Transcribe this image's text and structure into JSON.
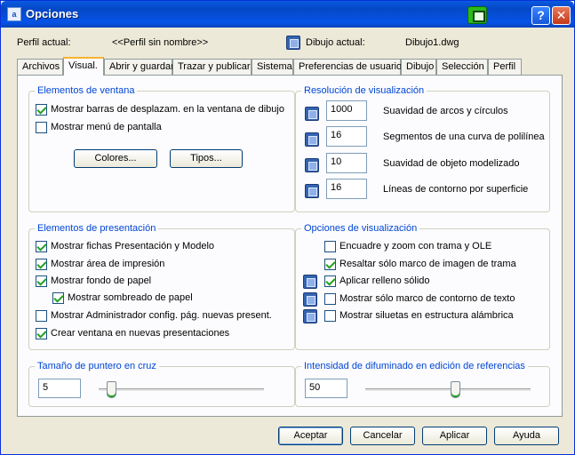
{
  "window": {
    "title": "Opciones",
    "app_icon_text": "a"
  },
  "header": {
    "profile_label": "Perfil actual:",
    "profile_value": "<<Perfil sin nombre>>",
    "drawing_label": "Dibujo actual:",
    "drawing_value": "Dibujo1.dwg"
  },
  "tabs": [
    {
      "label": "Archivos"
    },
    {
      "label": "Visual."
    },
    {
      "label": "Abrir y guardar"
    },
    {
      "label": "Trazar y publicar"
    },
    {
      "label": "Sistema"
    },
    {
      "label": "Preferencias de usuario"
    },
    {
      "label": "Dibujo"
    },
    {
      "label": "Selección"
    },
    {
      "label": "Perfil"
    }
  ],
  "window_elements": {
    "title": "Elementos de ventana",
    "scrollbars_label": "Mostrar barras de desplazam. en la ventana de dibujo",
    "scrollbars_checked": true,
    "screen_menu_label": "Mostrar menú de pantalla",
    "screen_menu_checked": false,
    "colors_button": "Colores...",
    "fonts_button": "Tipos..."
  },
  "resolution": {
    "title": "Resolución de visualización",
    "arc_value": "1000",
    "arc_label": "Suavidad de arcos y círculos",
    "segments_value": "16",
    "segments_label": "Segmentos de una curva de polilínea",
    "rendered_value": "10",
    "rendered_label": "Suavidad de objeto modelizado",
    "contour_value": "16",
    "contour_label": "Líneas de contorno por superficie"
  },
  "layout_elements": {
    "title": "Elementos de presentación",
    "items": [
      {
        "label": "Mostrar fichas Presentación y Modelo",
        "checked": true
      },
      {
        "label": "Mostrar área de impresión",
        "checked": true
      },
      {
        "label": "Mostrar fondo de papel",
        "checked": true
      },
      {
        "label": "Mostrar sombreado de papel",
        "checked": true
      },
      {
        "label": "Mostrar Administrador config. pág. nuevas present.",
        "checked": false
      },
      {
        "label": "Crear ventana en nuevas presentaciones",
        "checked": true
      }
    ]
  },
  "display_options": {
    "title": "Opciones de visualización",
    "items": [
      {
        "label": "Encuadre y zoom con trama y OLE",
        "checked": false
      },
      {
        "label": "Resaltar sólo marco de imagen de trama",
        "checked": true
      },
      {
        "label": "Aplicar relleno sólido",
        "checked": true
      },
      {
        "label": "Mostrar sólo marco de contorno de texto",
        "checked": false
      },
      {
        "label": "Mostrar siluetas en estructura alámbrica",
        "checked": false
      }
    ]
  },
  "crosshair": {
    "title": "Tamaño de puntero en cruz",
    "value": "5",
    "slider_fraction": 0.05
  },
  "xref_fade": {
    "title": "Intensidad de difuminado en edición de referencias",
    "value": "50",
    "slider_fraction": 0.55
  },
  "buttons": {
    "accept": "Aceptar",
    "cancel": "Cancelar",
    "apply": "Aplicar",
    "help": "Ayuda"
  },
  "colors": {
    "titlebar": "#0548c6",
    "group_title": "#0046d5",
    "tab_highlight": "#f9b232",
    "check": "#21a121"
  }
}
